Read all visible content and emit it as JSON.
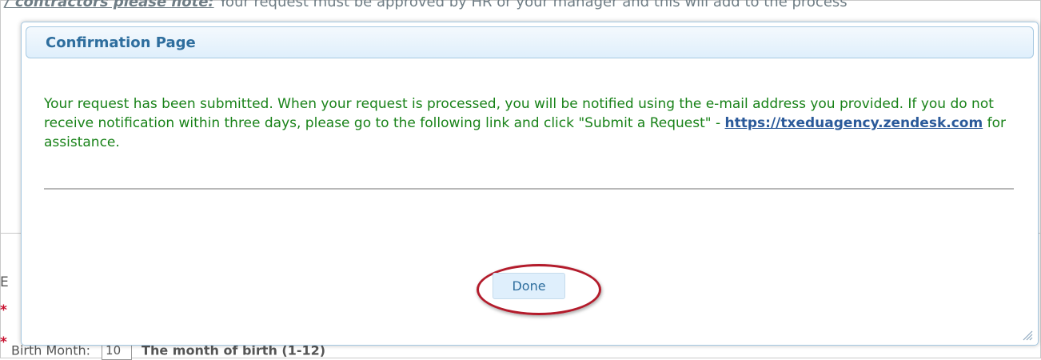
{
  "background": {
    "note_lead": "/ contractors please note:",
    "note_text": " Your request must be approved by HR or your manager and this will add to the process",
    "left_chars": [
      "E"
    ],
    "required_mark": "*",
    "birth_label": "Birth Month:",
    "birth_value": "10",
    "birth_hint": "The month of birth (1-12)"
  },
  "dialog": {
    "title": "Confirmation Page",
    "message_text": "Your request has been submitted. When your request is processed, you will be notified using the e-mail address you provided. If you do not receive notification within three days, please go to the following link and click \"Submit a Request\" - ",
    "message_link": "https://txeduagency.zendesk.com",
    "message_tail": " for assistance.",
    "done_label": "Done",
    "resize_icon": "resize-grip-icon"
  },
  "colors": {
    "message": "#188218",
    "title": "#2e6e9e",
    "highlight": "#b31b2b"
  }
}
